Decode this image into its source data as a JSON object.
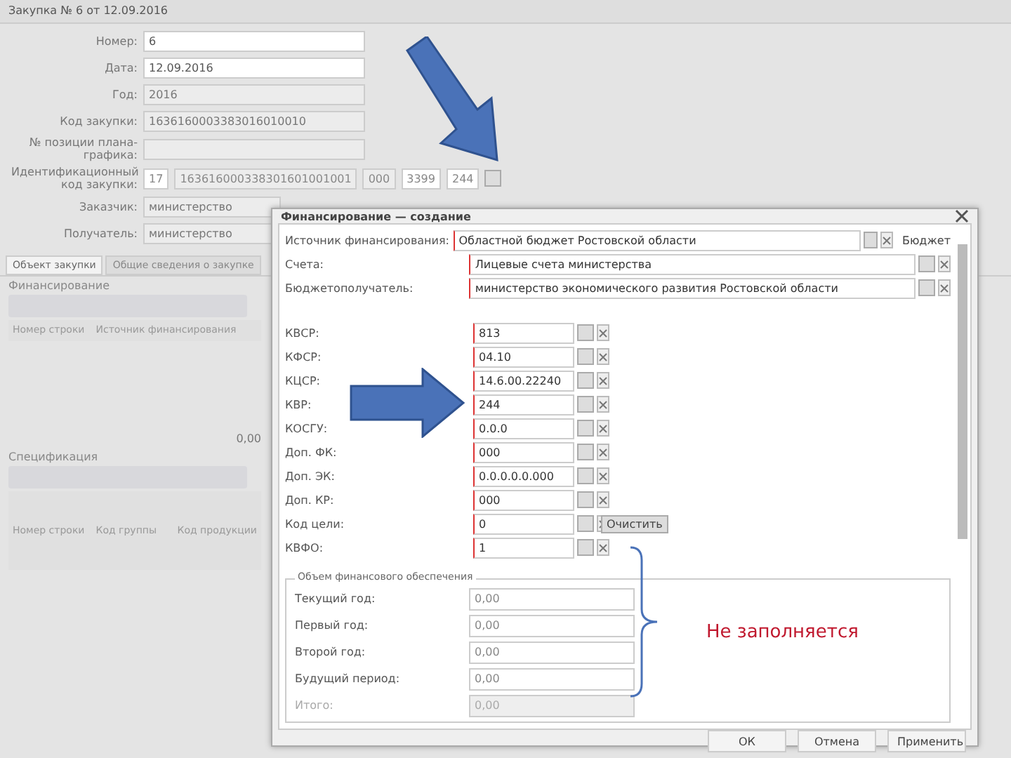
{
  "window": {
    "title": "Закупка № 6 от 12.09.2016"
  },
  "form": {
    "fields": [
      {
        "label": "Номер:",
        "value": "6",
        "disabled": false
      },
      {
        "label": "Дата:",
        "value": "12.09.2016",
        "disabled": false
      },
      {
        "label": "Год:",
        "value": "2016",
        "disabled": true
      },
      {
        "label": "Код закупки:",
        "value": "1636160003383016010010",
        "disabled": true
      },
      {
        "label": "№ позиции плана-графика:",
        "disabled": true
      }
    ],
    "id_code": {
      "label": "Идентификационный код закупки:",
      "parts": [
        "17",
        "163616000338301601001001",
        "000",
        "3399",
        "244"
      ]
    },
    "customer": {
      "label": "Заказчик:",
      "value": "министерство"
    },
    "recipient": {
      "label": "Получатель:",
      "value": "министерство"
    }
  },
  "tabs": [
    {
      "label": "Объект закупки",
      "selected": true
    },
    {
      "label": "Общие сведения о закупке",
      "selected": false
    }
  ],
  "funding_section": {
    "title": "Финансирование",
    "columns": [
      "Номер строки",
      "Источник финансирования"
    ],
    "total": "0,00"
  },
  "spec_section": {
    "title": "Спецификация",
    "columns": [
      "Номер строки",
      "Код группы",
      "Код продукции"
    ]
  },
  "dialog": {
    "title": "Финансирование — создание",
    "top_rows": [
      {
        "label": "Источник финансирования:",
        "value": "Областной бюджет Ростовской области",
        "extra": "Бюджет"
      },
      {
        "label": "Счета:",
        "value": "Лицевые счета министерства"
      },
      {
        "label": "Бюджетополучатель:",
        "value": "министерство экономического развития Ростовской области"
      }
    ],
    "code_rows": [
      {
        "label": "КВСР:",
        "value": "813"
      },
      {
        "label": "КФСР:",
        "value": "04.10"
      },
      {
        "label": "КЦСР:",
        "value": "14.6.00.22240"
      },
      {
        "label": "КВР:",
        "value": "244"
      },
      {
        "label": "КОСГУ:",
        "value": "0.0.0"
      },
      {
        "label": "Доп. ФК:",
        "value": "000"
      },
      {
        "label": "Доп. ЭК:",
        "value": "0.0.0.0.0.000"
      },
      {
        "label": "Доп. КР:",
        "value": "000"
      },
      {
        "label": "Код цели:",
        "value": "0"
      },
      {
        "label": "КВФО:",
        "value": "1"
      }
    ],
    "tooltip": "Очистить",
    "fieldset": {
      "legend": "Объем финансового обеспечения",
      "rows": [
        {
          "label": "Текущий год:",
          "value": "0,00",
          "disabled": false
        },
        {
          "label": "Первый год:",
          "value": "0,00",
          "disabled": false
        },
        {
          "label": "Второй год:",
          "value": "0,00",
          "disabled": false
        },
        {
          "label": "Будущий период:",
          "value": "0,00",
          "disabled": false
        },
        {
          "label": "Итого:",
          "value": "0,00",
          "disabled": true
        }
      ]
    },
    "buttons": [
      "ОК",
      "Отмена",
      "Применить"
    ]
  },
  "annotation": "Не заполняется"
}
